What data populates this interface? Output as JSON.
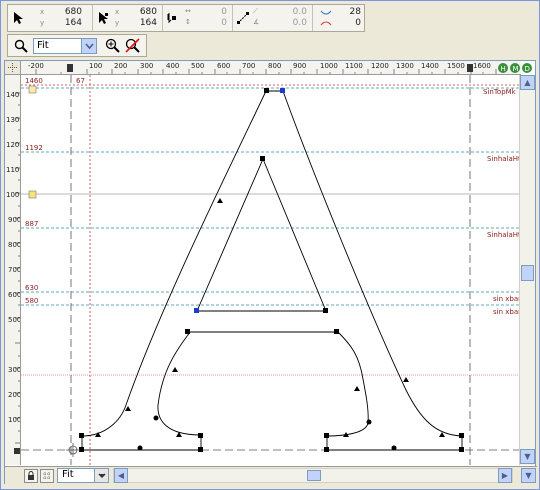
{
  "toolbar": {
    "pointer": {
      "x_label": "x",
      "y_label": "y",
      "x": "680",
      "y": "164"
    },
    "pointer2": {
      "x_label": "x",
      "y_label": "y",
      "x": "680",
      "y": "164"
    },
    "delta": {
      "x": "0",
      "y": "0"
    },
    "distance": {
      "len": "0.0",
      "angle": "0.0"
    },
    "point_count": {
      "a": "28",
      "b": "0"
    }
  },
  "zoom": {
    "value": "Fit"
  },
  "bottom_zoom": {
    "value": "Fit"
  },
  "ruler": {
    "top_ticks": [
      "-200",
      "0",
      "100",
      "200",
      "300",
      "400",
      "500",
      "600",
      "700",
      "800",
      "900",
      "1000",
      "1100",
      "1200",
      "1300",
      "1400",
      "1500",
      "1600"
    ],
    "left_ticks": [
      "1400",
      "1300",
      "1200",
      "1100",
      "1000",
      "900",
      "800",
      "700",
      "600",
      "500",
      "400",
      "300",
      "200",
      "100"
    ]
  },
  "guides": {
    "g1460": "1460",
    "g1192": "1192",
    "g887": "887",
    "g630": "630",
    "g580": "580",
    "x67": "67",
    "r1": "SinTopMk",
    "r2": "SinhalaHt",
    "r3": "SinhalaHt",
    "r4": "sin xbar",
    "r5": "sin xbar"
  },
  "colors": {
    "accent": "#7a96df",
    "guide_teal": "#2b8fa3",
    "guide_red": "#c0392b",
    "label_red": "#8b1a1a"
  }
}
